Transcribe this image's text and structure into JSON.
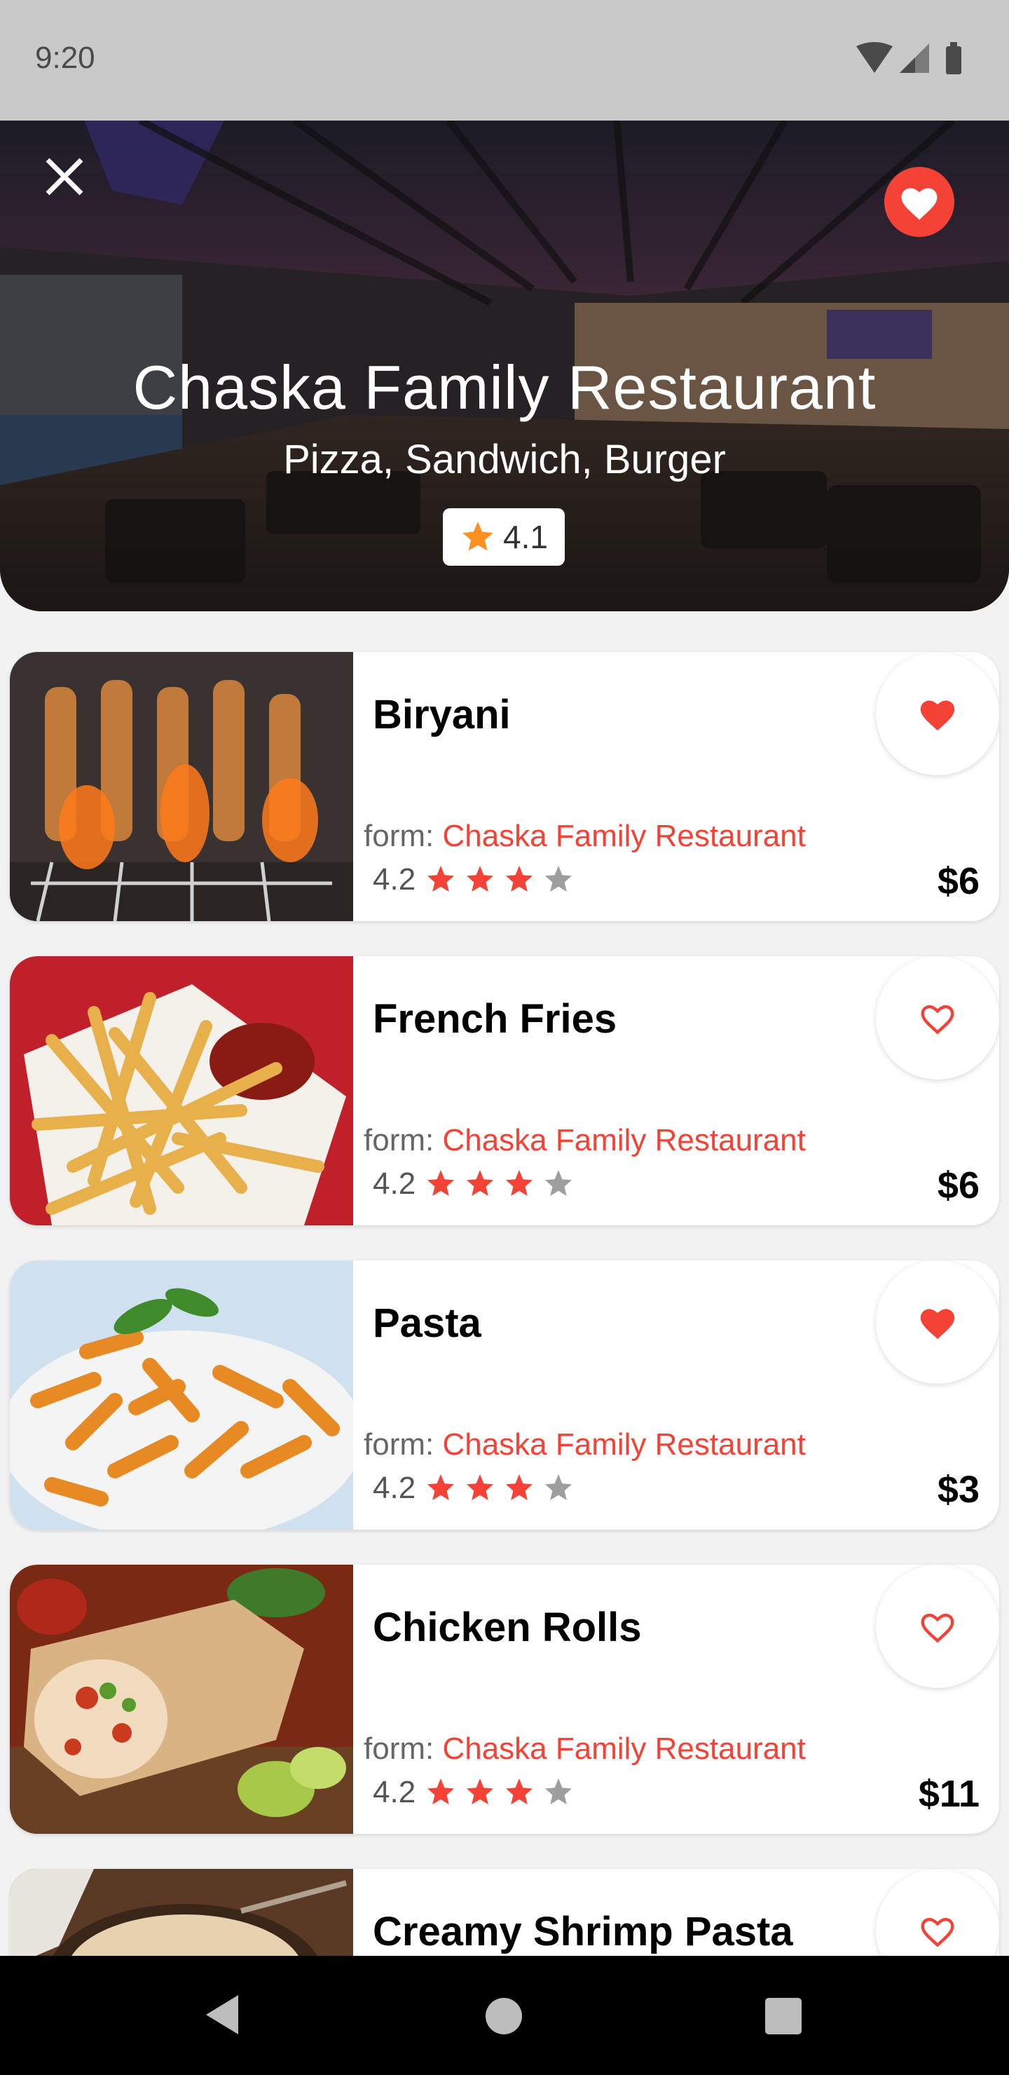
{
  "status_bar": {
    "time": "9:20"
  },
  "hero": {
    "title": "Chaska Family Restaurant",
    "subtitle": "Pizza, Sandwich, Burger",
    "rating": "4.1",
    "favorited": true
  },
  "colors": {
    "accent": "#f44336",
    "star_gold": "#ff8f1f",
    "star_empty": "#9e9e9e"
  },
  "items": [
    {
      "name": "Biryani",
      "from_label": "form: ",
      "restaurant": "Chaska Family Restaurant",
      "rating": "4.2",
      "stars": 3,
      "stars_total": 4,
      "price": "$6",
      "favorited": true
    },
    {
      "name": "French Fries",
      "from_label": "form: ",
      "restaurant": "Chaska Family Restaurant",
      "rating": "4.2",
      "stars": 3,
      "stars_total": 4,
      "price": "$6",
      "favorited": false
    },
    {
      "name": "Pasta",
      "from_label": "form: ",
      "restaurant": "Chaska Family Restaurant",
      "rating": "4.2",
      "stars": 3,
      "stars_total": 4,
      "price": "$3",
      "favorited": true
    },
    {
      "name": "Chicken Rolls",
      "from_label": "form: ",
      "restaurant": "Chaska Family Restaurant",
      "rating": "4.2",
      "stars": 3,
      "stars_total": 4,
      "price": "$11",
      "favorited": false
    },
    {
      "name": "Creamy Shrimp Pasta",
      "favorited": false
    }
  ],
  "icons": {
    "close": "close-icon",
    "hero_favorite": "heart-filled-icon",
    "rating": "star-icon",
    "favorite_on": "heart-filled-icon",
    "favorite_off": "heart-outline-icon",
    "nav": [
      "back-icon",
      "home-icon",
      "recents-icon"
    ]
  }
}
